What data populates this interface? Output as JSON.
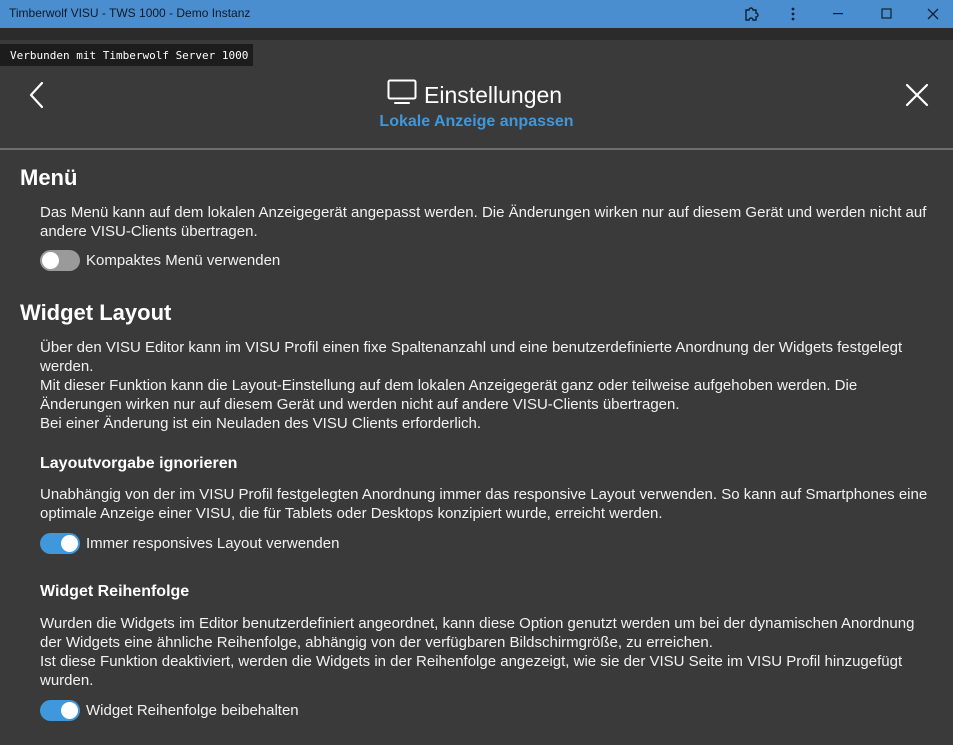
{
  "window": {
    "title": "Timberwolf VISU - TWS 1000 - Demo Instanz",
    "extension_icon": "puzzle-icon",
    "menu_icon": "more-vert-icon",
    "minimize_glyph": "—",
    "maximize_glyph": "☐",
    "close_glyph": "✕"
  },
  "connection": {
    "status": "Verbunden mit Timberwolf Server 1000"
  },
  "header": {
    "title": "Einstellungen",
    "subtitle": "Lokale Anzeige anpassen",
    "title_icon": "monitor-icon",
    "back_icon": "chevron-left-icon",
    "close_icon": "close-icon",
    "accent_color": "#3f97dc"
  },
  "menu_section": {
    "title": "Menü",
    "description": "Das Menü kann auf dem lokalen Anzeigegerät angepasst werden. Die Änderungen wirken nur auf diesem Gerät und werden nicht auf andere VISU-Clients übertragen.",
    "toggle": {
      "label": "Kompaktes Menü verwenden",
      "checked": false
    }
  },
  "layout_section": {
    "title": "Widget Layout",
    "description_lines": [
      "Über den VISU Editor kann im VISU Profil einen fixe Spaltenanzahl und eine benutzerdefinierte Anordnung der Widgets festgelegt werden.",
      "Mit dieser Funktion kann die Layout-Einstellung auf dem lokalen Anzeigegerät ganz oder teilweise aufgehoben werden. Die Änderungen wirken nur auf diesem Gerät und werden nicht auf andere VISU-Clients übertragen.",
      "Bei einer Änderung ist ein Neuladen des VISU Clients erforderlich."
    ],
    "ignore": {
      "title": "Layoutvorgabe ignorieren",
      "description": "Unabhängig von der im VISU Profil festgelegten Anordnung immer das responsive Layout verwenden. So kann auf Smartphones eine optimale Anzeige einer VISU, die für Tablets oder Desktops konzipiert wurde, erreicht werden.",
      "toggle": {
        "label": "Immer responsives Layout verwenden",
        "checked": true
      }
    },
    "order": {
      "title": "Widget Reihenfolge",
      "description_lines": [
        "Wurden die Widgets im Editor benutzerdefiniert angeordnet, kann diese Option genutzt werden um bei der dynamischen Anordnung der Widgets eine ähnliche Reihenfolge, abhängig von der verfügbaren Bildschirmgröße, zu erreichen.",
        "Ist diese Funktion deaktiviert, werden die Widgets in der Reihenfolge angezeigt, wie sie der VISU Seite im VISU Profil hinzugefügt wurden."
      ],
      "toggle": {
        "label": "Widget Reihenfolge beibehalten",
        "checked": true
      }
    }
  }
}
